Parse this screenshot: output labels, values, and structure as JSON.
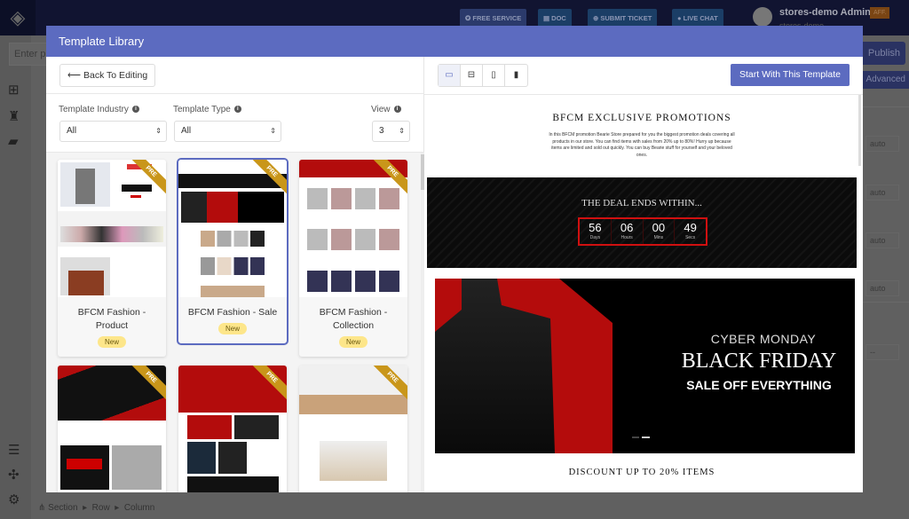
{
  "topbar": {
    "buttons": [
      "FREE SERVICE",
      "DOC",
      "SUBMIT TICKET",
      "LIVE CHAT"
    ],
    "user_name": "stores-demo Admin",
    "user_sub": "stores-demo",
    "aff_badge": "AFF."
  },
  "editor": {
    "page_name_placeholder": "Enter p",
    "publish": "Publish",
    "advanced": "Advanced",
    "auto_values": [
      "auto",
      "auto",
      "auto",
      "auto"
    ],
    "select_value": "--",
    "breadcrumb": [
      "Section",
      "Row",
      "Column"
    ]
  },
  "modal": {
    "title": "Template Library",
    "back_label": "Back To Editing",
    "start_label": "Start With This Template",
    "devices": [
      "desktop-icon",
      "laptop-icon",
      "tablet-icon",
      "mobile-icon"
    ],
    "filters": {
      "industry_label": "Template Industry",
      "industry_value": "All",
      "type_label": "Template Type",
      "type_value": "All",
      "view_label": "View",
      "view_value": "3"
    },
    "templates": [
      {
        "title": "BFCM Fashion - Product",
        "badge": "New",
        "ribbon": "PRE"
      },
      {
        "title": "BFCM Fashion - Sale",
        "badge": "New",
        "ribbon": "PRE",
        "selected": true
      },
      {
        "title": "BFCM Fashion - Collection",
        "badge": "New",
        "ribbon": "PRE"
      },
      {
        "title": "",
        "ribbon": "PRE"
      },
      {
        "title": "",
        "ribbon": "PRE"
      },
      {
        "title": "",
        "ribbon": "PRE"
      }
    ],
    "preview": {
      "heading": "BFCM EXCLUSIVE PROMOTIONS",
      "description": "In this BFCM promotion Bearie Store prepared for you the biggest promotion deals covering all products in our store. You can find items with sales from 20% up to 80%! Hurry up because items are limited and sold out quickly. You can buy Bearie stuff for yourself and your beloved ones.",
      "deal_title": "THE DEAL ENDS WITHIN...",
      "countdown": [
        {
          "value": "56",
          "label": "Days"
        },
        {
          "value": "06",
          "label": "Hours"
        },
        {
          "value": "00",
          "label": "Mins"
        },
        {
          "value": "49",
          "label": "Secs"
        }
      ],
      "banner": {
        "line1": "CYBER MONDAY",
        "line2": "BLACK FRIDAY",
        "line3": "SALE OFF EVERYTHING"
      },
      "section_title": "DISCOUNT UP TO 20% ITEMS"
    }
  },
  "colors": {
    "accent": "#5c6bc0",
    "countdown_border": "#d01010",
    "banner_red": "#b40c0c",
    "badge": "#fde68a",
    "ribbon": "#c9961a"
  }
}
